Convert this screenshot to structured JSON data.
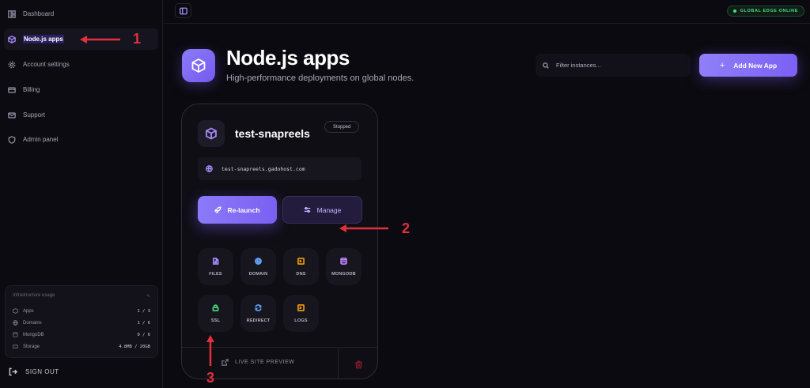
{
  "sidebar": {
    "items": [
      {
        "label": "Dashboard",
        "icon": "dashboard-icon"
      },
      {
        "label": "Node.js apps",
        "icon": "cube-icon"
      },
      {
        "label": "Account settings",
        "icon": "gear-icon"
      },
      {
        "label": "Billing",
        "icon": "card-icon"
      },
      {
        "label": "Support",
        "icon": "mail-icon"
      },
      {
        "label": "Admin panel",
        "icon": "shield-icon"
      }
    ],
    "usage": {
      "title": "Infrastructure usage",
      "rows": [
        {
          "label": "Apps",
          "value": "1 / 3"
        },
        {
          "label": "Domains",
          "value": "1 / 6"
        },
        {
          "label": "MongoDB",
          "value": "0 / 6"
        },
        {
          "label": "Storage",
          "value": "4.8MB / 20GB"
        }
      ]
    },
    "signout": "SIGN OUT"
  },
  "topbar": {
    "status": "GLOBAL EDGE ONLINE"
  },
  "header": {
    "title": "Node.js apps",
    "subtitle": "High-performance deployments on global nodes.",
    "search_placeholder": "Filter instances...",
    "add_button": "Add New App"
  },
  "card": {
    "name": "test-snapreels",
    "status": "Stopped",
    "domain": "test-snapreels.gadohost.com",
    "relaunch": "Re-launch",
    "manage": "Manage",
    "tiles": [
      {
        "label": "FILES",
        "icon": "file-icon",
        "color": "#a78bfa"
      },
      {
        "label": "DOMAIN",
        "icon": "globe-icon",
        "color": "#60a5fa"
      },
      {
        "label": "DNS",
        "icon": "terminal-icon",
        "color": "#f59e0b"
      },
      {
        "label": "MONGODB",
        "icon": "database-icon",
        "color": "#c084fc"
      },
      {
        "label": "SSL",
        "icon": "lock-icon",
        "color": "#4ade80"
      },
      {
        "label": "REDIRECT",
        "icon": "refresh-icon",
        "color": "#60a5fa"
      },
      {
        "label": "LOGS",
        "icon": "terminal-icon",
        "color": "#f59e0b"
      }
    ],
    "preview": "LIVE SITE PREVIEW"
  },
  "annotations": {
    "one": "1",
    "two": "2",
    "three": "3"
  },
  "colors": {
    "accent": "#7c5cf4",
    "arrow": "#e0313b",
    "online": "#4ade80"
  }
}
